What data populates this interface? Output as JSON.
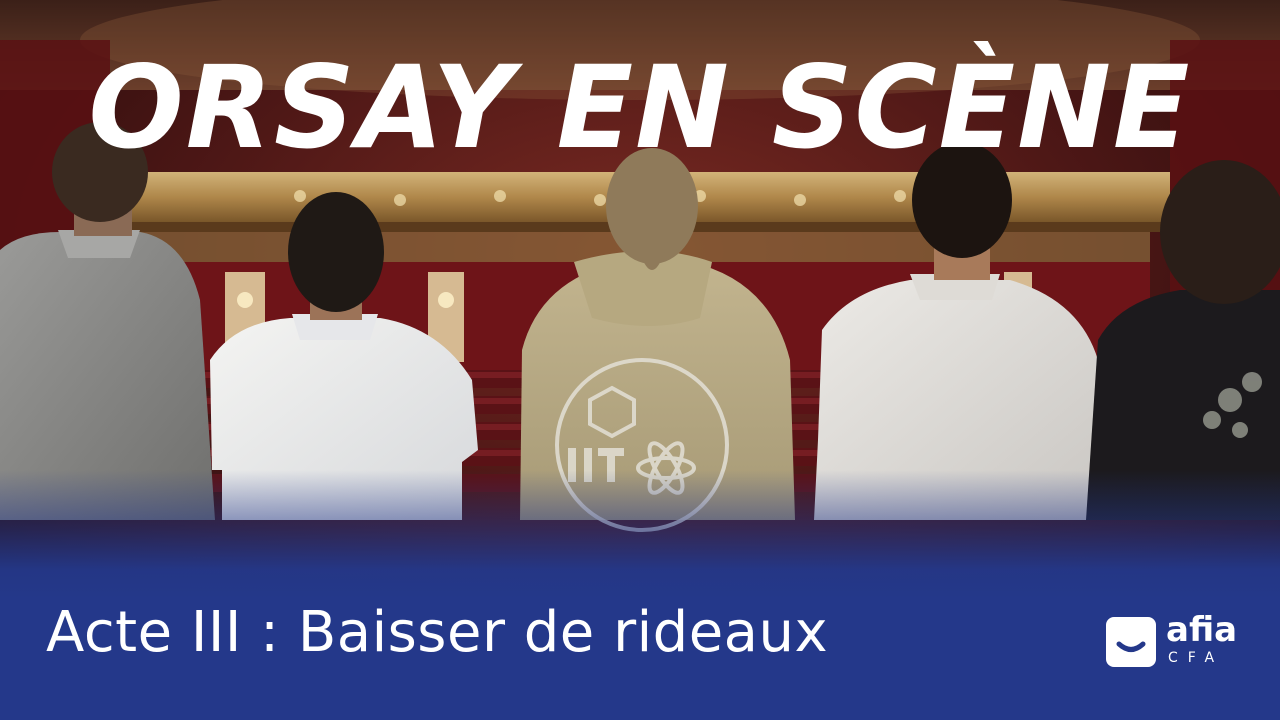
{
  "title": "ORSAY EN SCÈNE",
  "subtitle": "Acte III : Baisser de rideaux",
  "logo": {
    "word": "afia",
    "sub": "CFA"
  },
  "colors": {
    "band": "#24388a",
    "text": "#ffffff",
    "theatre_red": "#6e1418",
    "gold": "#c9a45a"
  }
}
